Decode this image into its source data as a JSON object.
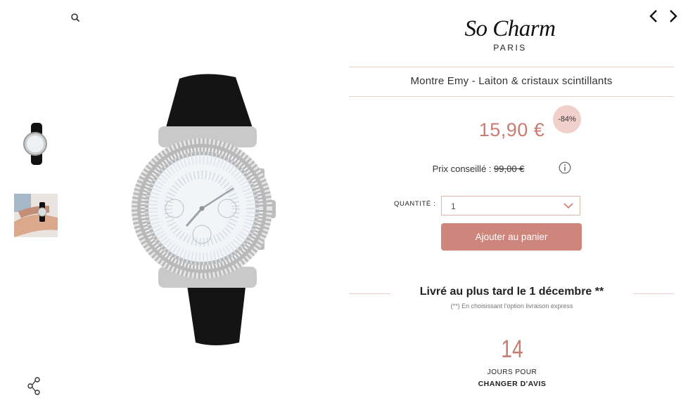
{
  "brand": {
    "name": "So Charm",
    "subtitle": "PARIS"
  },
  "product": {
    "title": "Montre Emy - Laiton & cristaux scintillants",
    "price": "15,90 €",
    "discount": "-84%",
    "rrp_label": "Prix conseillé :",
    "rrp_value": "99,00 €"
  },
  "quantity": {
    "label": "QUANTITÉ :",
    "value": "1"
  },
  "cart": {
    "add_label": "Ajouter au panier"
  },
  "delivery": {
    "title": "Livré au plus tard le 1 décembre **",
    "note": "(**) En choisissant l'option livraison express"
  },
  "returns": {
    "days": "14",
    "line1": "JOURS POUR",
    "line2": "CHANGER D'AVIS"
  },
  "colors": {
    "accent": "#cd857c",
    "price": "#c97b72",
    "badge": "#f1cfcb",
    "rule": "#e9cfc9"
  },
  "icons": [
    "search-icon",
    "share-icon",
    "chevron-left-icon",
    "chevron-right-icon",
    "info-icon",
    "chevron-down-icon"
  ]
}
